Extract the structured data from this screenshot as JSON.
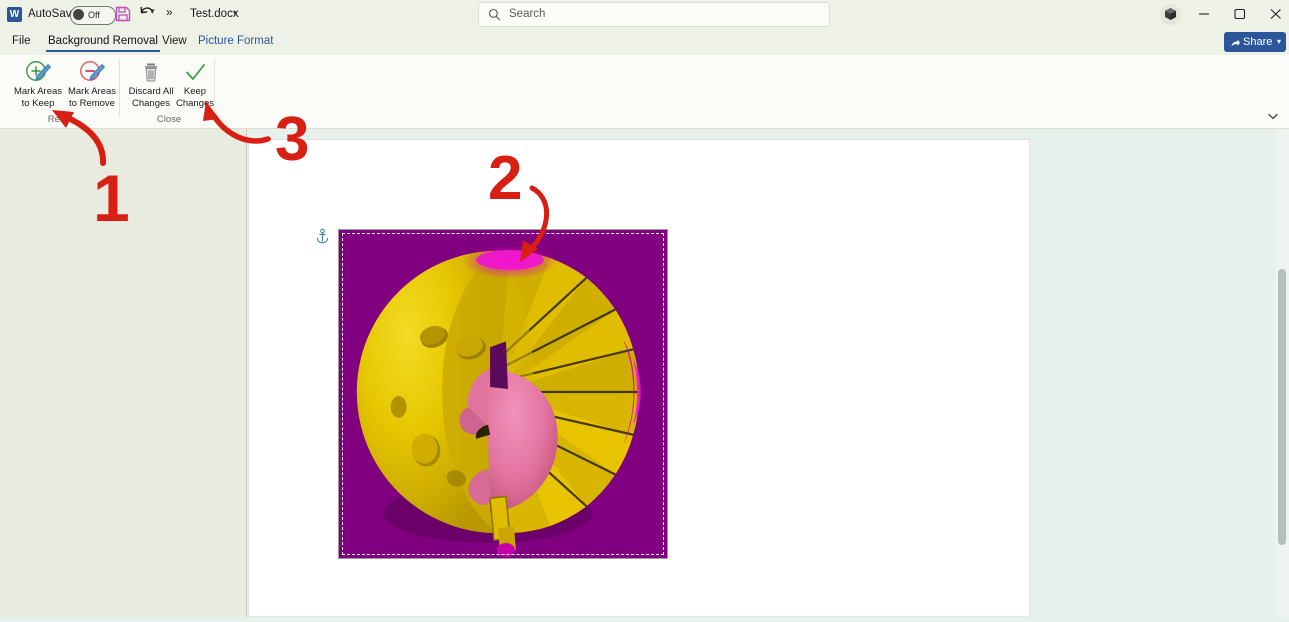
{
  "app": {
    "logo_icon": "word-logo-icon",
    "autosave_label": "AutoSave",
    "autosave_state": "Off",
    "save_icon": "save-disk-icon",
    "undo_icon": "undo-icon",
    "undo_chevron_icon": "chevron-down-icon",
    "more_commands_icon": "overflow-chevrons-icon",
    "document_name": "Test.docx",
    "document_chevron_icon": "chevron-down-icon"
  },
  "search": {
    "icon": "search-icon",
    "placeholder": "Search"
  },
  "window": {
    "account_icon": "cube-icon",
    "minimize_icon": "minimize-icon",
    "maximize_icon": "maximize-icon",
    "close_icon": "close-icon"
  },
  "share": {
    "icon": "share-icon",
    "label": "Share",
    "chevron_icon": "chevron-down-icon",
    "color": "#2b579a"
  },
  "tabs": [
    {
      "id": "file",
      "label": "File",
      "active": false
    },
    {
      "id": "background-removal",
      "label": "Background Removal",
      "active": true
    },
    {
      "id": "view",
      "label": "View",
      "active": false
    },
    {
      "id": "picture-format",
      "label": "Picture Format",
      "active": false,
      "color": "#2b579a"
    }
  ],
  "ribbon": {
    "collapse_icon": "chevron-down-icon",
    "groups": [
      {
        "id": "refine",
        "label": "Refine",
        "buttons": [
          {
            "id": "mark-areas-to-keep",
            "line1": "Mark Areas",
            "line2": "to Keep",
            "icon": "mark-keep-icon",
            "icon_color": "#3f9c49"
          },
          {
            "id": "mark-areas-to-remove",
            "line1": "Mark Areas",
            "line2": "to Remove",
            "icon": "mark-remove-icon",
            "icon_color": "#e06070"
          }
        ]
      },
      {
        "id": "close",
        "label": "Close",
        "buttons": [
          {
            "id": "discard-all-changes",
            "line1": "Discard All",
            "line2": "Changes",
            "icon": "trash-icon",
            "icon_color": "#8a8a8a"
          },
          {
            "id": "keep-changes",
            "line1": "Keep",
            "line2": "Changes",
            "icon": "checkmark-icon",
            "icon_color": "#3f9c49"
          }
        ]
      }
    ]
  },
  "document": {
    "anchor_icon": "anchor-icon",
    "picture": {
      "name": "3d-model-picture",
      "background_removal_overlay_color": "#800080",
      "highlight_color": "#e000c8",
      "object_color": "#e8c400",
      "object_accent_color": "#e06a9e",
      "selected": true
    }
  },
  "scrollbar": {
    "vertical_thumb": "vertical-scrollbar-thumb"
  },
  "annotations": [
    {
      "id": "step-1",
      "label": "1",
      "color": "#d81f13",
      "points_to": "mark-areas-to-keep"
    },
    {
      "id": "step-2",
      "label": "2",
      "color": "#d81f13",
      "points_to": "picture-marked-area"
    },
    {
      "id": "step-3",
      "label": "3",
      "color": "#d81f13",
      "points_to": "keep-changes"
    }
  ]
}
